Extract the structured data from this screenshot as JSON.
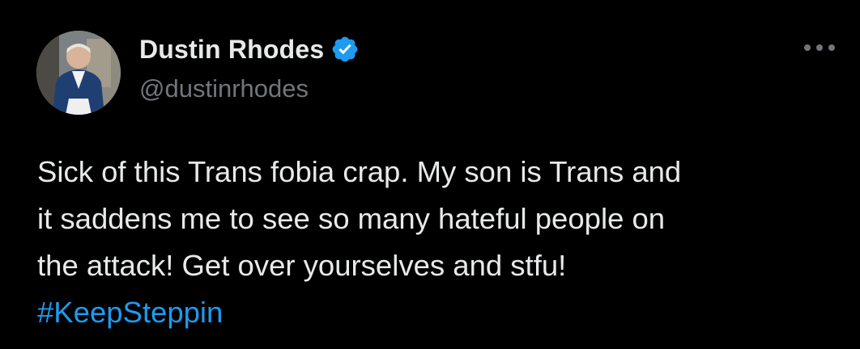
{
  "tweet": {
    "author": {
      "display_name": "Dustin Rhodes",
      "handle": "@dustinrhodes",
      "verified": true,
      "verified_badge_color": "#1d9bf0"
    },
    "more_menu_icon": "more-horizontal-icon",
    "text_lines": [
      "Sick of this Trans fobia crap. My son is Trans and",
      "it saddens me to see so many hateful people on",
      "the attack! Get over yourselves and stfu!"
    ],
    "hashtag": "#KeepSteppin"
  },
  "colors": {
    "background": "#000000",
    "primary_text": "#e7e9ea",
    "secondary_text": "#71767b",
    "link": "#1d9bf0"
  }
}
